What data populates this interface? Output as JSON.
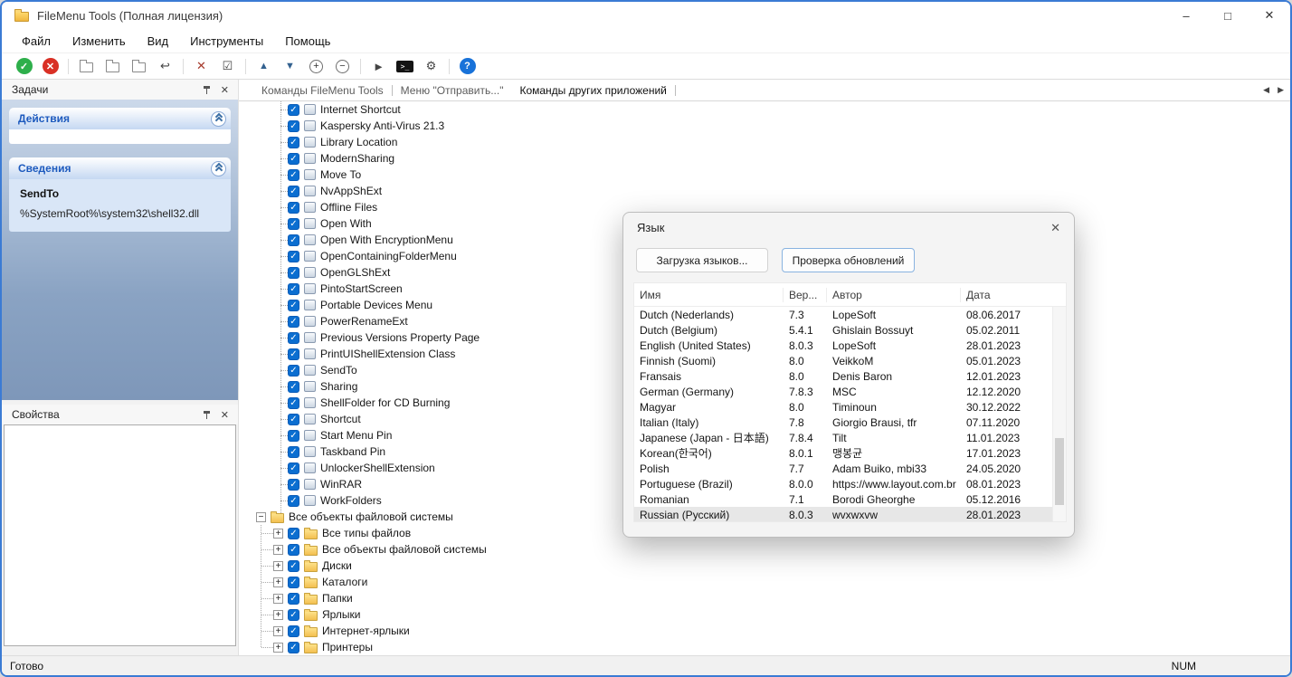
{
  "window": {
    "title": "FileMenu Tools (Полная лицензия)",
    "controls": {
      "minimize": "–",
      "maximize": "□",
      "close": "✕"
    }
  },
  "menu": {
    "items": [
      "Файл",
      "Изменить",
      "Вид",
      "Инструменты",
      "Помощь"
    ]
  },
  "toolbar": {
    "buttons": {
      "apply": "✓",
      "cancel": "✕",
      "undo": "↩",
      "delete": "✕",
      "checkbox": "☑",
      "move_up": "▲",
      "move_down": "▼",
      "expand_all": "+",
      "collapse_all": "−",
      "run": "►",
      "console": ">_",
      "settings": "⚙",
      "help": "?"
    }
  },
  "sidebar": {
    "tasks": {
      "title": "Задачи",
      "close_glyph": "✕"
    },
    "actions_section": {
      "title": "Действия"
    },
    "details_section": {
      "title": "Сведения",
      "item_name": "SendTo",
      "item_path": "%SystemRoot%\\system32\\shell32.dll"
    },
    "properties": {
      "title": "Свойства",
      "close_glyph": "✕"
    }
  },
  "tabs": {
    "items": [
      {
        "label": "Команды FileMenu Tools"
      },
      {
        "label": "Меню \"Отправить...\""
      },
      {
        "label": "Команды других приложений"
      }
    ],
    "nav_prev": "◀",
    "nav_next": "▶"
  },
  "icons": {
    "check": "✓",
    "expand": "+",
    "collapse": "−"
  },
  "tree": {
    "items": [
      "Internet Shortcut",
      "Kaspersky Anti-Virus 21.3",
      "Library Location",
      "ModernSharing",
      "Move To",
      "NvAppShExt",
      "Offline Files",
      "Open With",
      "Open With EncryptionMenu",
      "OpenContainingFolderMenu",
      "OpenGLShExt",
      "PintoStartScreen",
      "Portable Devices Menu",
      "PowerRenameExt",
      "Previous Versions Property Page",
      "PrintUIShellExtension Class",
      "SendTo",
      "Sharing",
      "ShellFolder for CD Burning",
      "Shortcut",
      "Start Menu Pin",
      "Taskband Pin",
      "UnlockerShellExtension",
      "WinRAR",
      "WorkFolders"
    ],
    "folder_root": "Все объекты файловой системы",
    "folder_children": [
      "Все типы файлов",
      "Все объекты файловой системы",
      "Диски",
      "Каталоги",
      "Папки",
      "Ярлыки",
      "Интернет-ярлыки",
      "Принтеры"
    ]
  },
  "dialog": {
    "title": "Язык",
    "close_glyph": "✕",
    "download_button": "Загрузка языков...",
    "check_updates_button": "Проверка обновлений",
    "table": {
      "columns": [
        "Имя",
        "Вер...",
        "Автор",
        "Дата"
      ],
      "rows": [
        {
          "name": "Dutch (Nederlands)",
          "ver": "7.3",
          "author": "LopeSoft",
          "date": "08.06.2017"
        },
        {
          "name": "Dutch (Belgium)",
          "ver": "5.4.1",
          "author": "Ghislain Bossuyt",
          "date": "05.02.2011"
        },
        {
          "name": "English (United States)",
          "ver": "8.0.3",
          "author": "LopeSoft",
          "date": "28.01.2023"
        },
        {
          "name": "Finnish (Suomi)",
          "ver": "8.0",
          "author": "VeikkoM",
          "date": "05.01.2023"
        },
        {
          "name": "Fransais",
          "ver": "8.0",
          "author": "Denis Baron",
          "date": "12.01.2023"
        },
        {
          "name": "German (Germany)",
          "ver": "7.8.3",
          "author": "MSC",
          "date": "12.12.2020"
        },
        {
          "name": "Magyar",
          "ver": "8.0",
          "author": "Timinoun",
          "date": "30.12.2022"
        },
        {
          "name": "Italian (Italy)",
          "ver": "7.8",
          "author": "Giorgio Brausi, tfr",
          "date": "07.11.2020"
        },
        {
          "name": "Japanese (Japan - 日本語)",
          "ver": "7.8.4",
          "author": "Tilt",
          "date": "11.01.2023"
        },
        {
          "name": "Korean(한국어)",
          "ver": "8.0.1",
          "author": "맹봉균",
          "date": "17.01.2023"
        },
        {
          "name": "Polish",
          "ver": "7.7",
          "author": "Adam Buiko, mbi33",
          "date": "24.05.2020"
        },
        {
          "name": "Portuguese (Brazil)",
          "ver": "8.0.0",
          "author": "https://www.layout.com.br",
          "date": "08.01.2023"
        },
        {
          "name": "Romanian",
          "ver": "7.1",
          "author": "Borodi Gheorghe",
          "date": "05.12.2016"
        },
        {
          "name": "Russian (Русский)",
          "ver": "8.0.3",
          "author": "wvxwxvw",
          "date": "28.01.2023",
          "selected": true
        }
      ]
    }
  },
  "statusbar": {
    "left": "Готово",
    "right": "NUM"
  },
  "colors": {
    "accent_blue": "#0b6ed0",
    "window_border": "#3b7bd4",
    "apply_green": "#2eaf4b",
    "cancel_red": "#d93025"
  }
}
